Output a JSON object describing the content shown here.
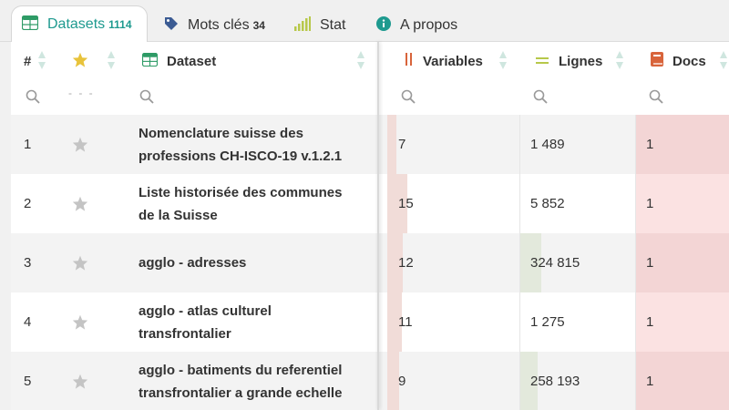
{
  "tabs": [
    {
      "label": "Datasets",
      "count": "1114",
      "icon": "table-icon"
    },
    {
      "label": "Mots clés",
      "count": "34",
      "icon": "tag-icon"
    },
    {
      "label": "Stat",
      "icon": "signal-bars-icon"
    },
    {
      "label": "A propos",
      "icon": "info-icon"
    }
  ],
  "headers": {
    "num": "#",
    "star": "star-icon",
    "dataset": "Dataset",
    "variables": "Variables",
    "lignes": "Lignes",
    "docs": "Docs"
  },
  "filters": {
    "star_placeholder": "- - -"
  },
  "colors": {
    "accent": "#1e9a8f",
    "variables_bar": "#f1dcd8",
    "lignes_bar": "#e3e9dc",
    "docs_bg": "#f6d7d7",
    "star": "#e8c33b"
  },
  "rows": [
    {
      "num": "1",
      "name_line1": "Nomenclature suisse des",
      "name_line2": "professions CH-ISCO-19 v.1.2.1",
      "variables": "7",
      "lignes": "1 489",
      "docs": "1",
      "variables_bar_fraction": 0.08,
      "lignes_bar_fraction": 0.0
    },
    {
      "num": "2",
      "name_line1": "Liste historisée des communes",
      "name_line2": "de la Suisse",
      "variables": "15",
      "lignes": "5 852",
      "docs": "1",
      "variables_bar_fraction": 0.17,
      "lignes_bar_fraction": 0.0
    },
    {
      "num": "3",
      "name_line1": "agglo - adresses",
      "name_line2": "",
      "variables": "12",
      "lignes": "324 815",
      "docs": "1",
      "variables_bar_fraction": 0.13,
      "lignes_bar_fraction": 0.18
    },
    {
      "num": "4",
      "name_line1": "agglo - atlas culturel",
      "name_line2": "transfrontalier",
      "variables": "11",
      "lignes": "1 275",
      "docs": "1",
      "variables_bar_fraction": 0.12,
      "lignes_bar_fraction": 0.0
    },
    {
      "num": "5",
      "name_line1": "agglo - batiments du referentiel",
      "name_line2": "transfrontalier a grande echelle",
      "variables": "9",
      "lignes": "258 193",
      "docs": "1",
      "variables_bar_fraction": 0.1,
      "lignes_bar_fraction": 0.15
    }
  ]
}
